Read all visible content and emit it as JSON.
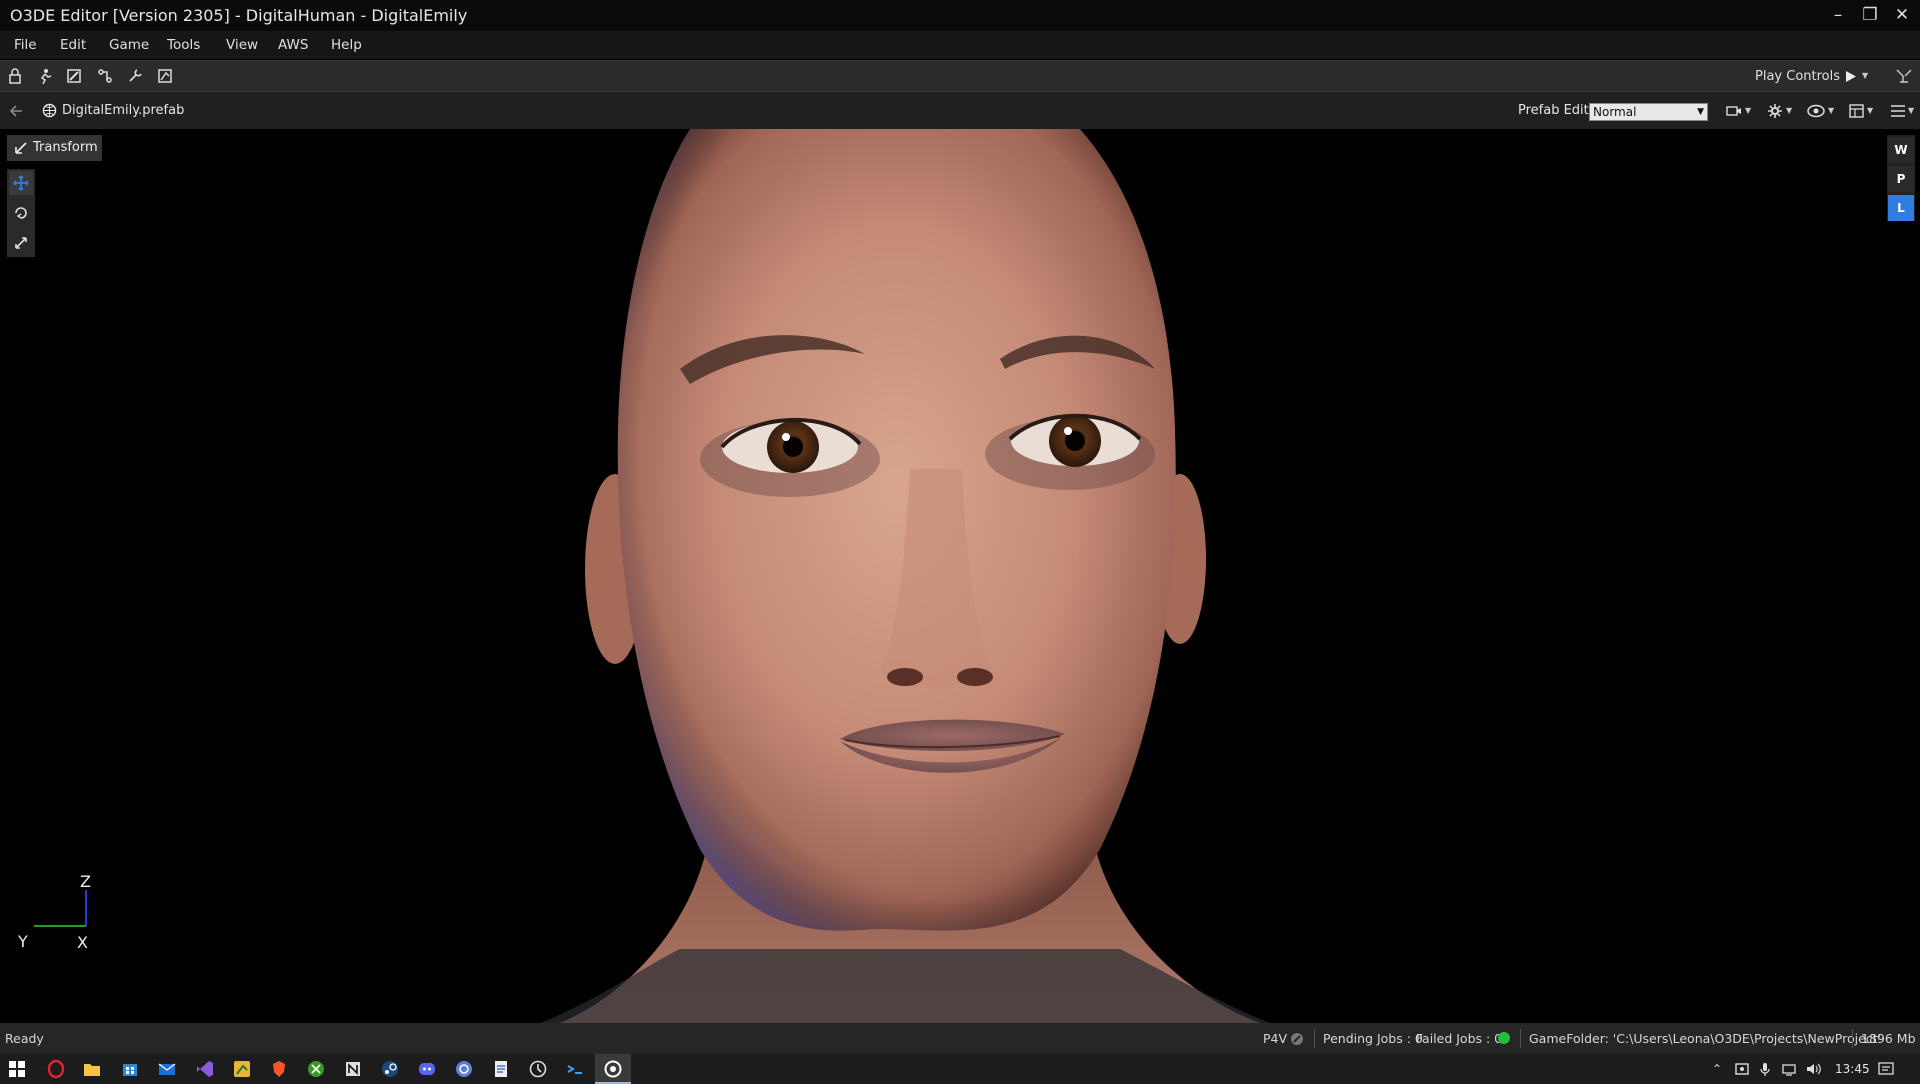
{
  "window": {
    "title": "O3DE Editor [Version 2305] - DigitalHuman - DigitalEmily"
  },
  "menu": [
    {
      "label": "File"
    },
    {
      "label": "Edit"
    },
    {
      "label": "Game"
    },
    {
      "label": "Tools"
    },
    {
      "label": "View"
    },
    {
      "label": "AWS"
    },
    {
      "label": "Help"
    }
  ],
  "toolbar": {
    "play_controls_label": "Play Controls"
  },
  "prefab_bar": {
    "prefab_name": "DigitalEmily.prefab",
    "prefab_edit_label": "Prefab Edit:",
    "prefab_edit_value": "Normal"
  },
  "viewport": {
    "transform_label": "Transform",
    "space_buttons": [
      "W",
      "P",
      "L"
    ],
    "active_space": "L",
    "axis_labels": {
      "z": "Z",
      "y": "Y",
      "x": "X"
    }
  },
  "status": {
    "ready": "Ready",
    "p4v": "P4V",
    "pending_jobs": "Pending Jobs : 0",
    "failed_jobs": "Failed Jobs : 0",
    "game_folder": "GameFolder: 'C:\\Users\\Leona\\O3DE\\Projects\\NewProject'",
    "memory": "1896 Mb"
  },
  "taskbar": {
    "clock": "13:45"
  },
  "colors": {
    "accent_blue": "#2f7de1",
    "status_green": "#1fbf3a"
  }
}
